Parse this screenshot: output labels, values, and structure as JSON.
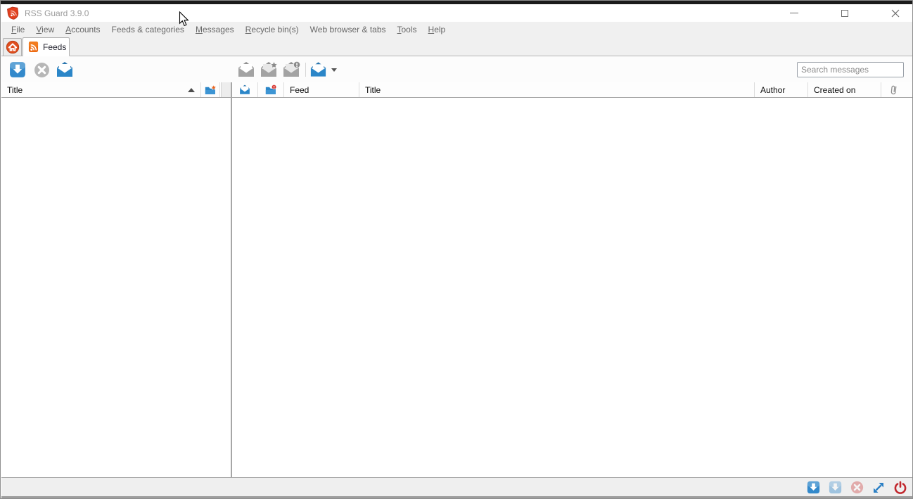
{
  "window": {
    "title": "RSS Guard 3.9.0"
  },
  "title_bar_controls": {
    "minimize_icon": "minimize-icon",
    "maximize_icon": "maximize-icon",
    "close_icon": "close-icon"
  },
  "menu_bar": {
    "items": [
      {
        "label": "File",
        "mnemonic": 0
      },
      {
        "label": "View",
        "mnemonic": 0
      },
      {
        "label": "Accounts",
        "mnemonic": 0
      },
      {
        "label": "Feeds & categories",
        "mnemonic": -1
      },
      {
        "label": "Messages",
        "mnemonic": 0
      },
      {
        "label": "Recycle bin(s)",
        "mnemonic": 0
      },
      {
        "label": "Web browser & tabs",
        "mnemonic": -1
      },
      {
        "label": "Tools",
        "mnemonic": 0
      },
      {
        "label": "Help",
        "mnemonic": 0
      }
    ]
  },
  "tab_bar": {
    "tabs": [
      {
        "id": "home",
        "icon": "home-icon",
        "label": "",
        "active": false
      },
      {
        "id": "feeds",
        "icon": "rss-feed-icon",
        "label": "Feeds",
        "active": true
      }
    ]
  },
  "feeds_toolbar": {
    "buttons": [
      {
        "id": "update-feeds",
        "icon": "download-icon",
        "enabled": true
      },
      {
        "id": "stop-update",
        "icon": "cancel-circle-icon",
        "enabled": false
      },
      {
        "id": "mark-feed-read",
        "icon": "open-envelope-icon",
        "enabled": true
      }
    ]
  },
  "messages_toolbar": {
    "buttons": [
      {
        "id": "mark-message-read",
        "icon": "open-envelope-gray-icon",
        "enabled": false
      },
      {
        "id": "mark-message-starred",
        "icon": "envelope-star-gray-icon",
        "enabled": false
      },
      {
        "id": "mark-message-important",
        "icon": "envelope-exclamation-gray-icon",
        "enabled": false
      },
      {
        "id": "mark-all-read",
        "icon": "open-envelope-icon",
        "enabled": true,
        "has_dropdown": true
      }
    ]
  },
  "search_box": {
    "placeholder": "Search messages",
    "value": ""
  },
  "feed_list": {
    "header": {
      "title_column": "Title",
      "sort_direction": "ascending",
      "counts_column_icon": "folder-star-icon"
    },
    "items": []
  },
  "message_list": {
    "header": {
      "read_column_icon": "open-envelope-icon",
      "importance_column_icon": "folder-exclamation-icon",
      "columns": [
        "Feed",
        "Title",
        "Author",
        "Created on"
      ],
      "attachment_column_icon": "paperclip-icon"
    },
    "items": []
  },
  "status_bar": {
    "buttons": [
      {
        "id": "update-all-feeds",
        "icon": "download-icon",
        "enabled": true
      },
      {
        "id": "update-selected-feeds",
        "icon": "download-icon",
        "enabled": false
      },
      {
        "id": "stop-running-update",
        "icon": "cancel-red-circle-icon",
        "enabled": false
      },
      {
        "id": "toggle-fullscreen",
        "icon": "fullscreen-arrows-icon",
        "enabled": true
      },
      {
        "id": "quit-application",
        "icon": "power-icon",
        "enabled": true
      }
    ]
  },
  "colors": {
    "accent_blue": "#2b86c8",
    "accent_orange": "#e8581f",
    "shield_red": "#e2401f",
    "disabled_gray": "#a3a3a3",
    "power_red": "#c1272d",
    "statusbar_bg": "#efefef"
  }
}
